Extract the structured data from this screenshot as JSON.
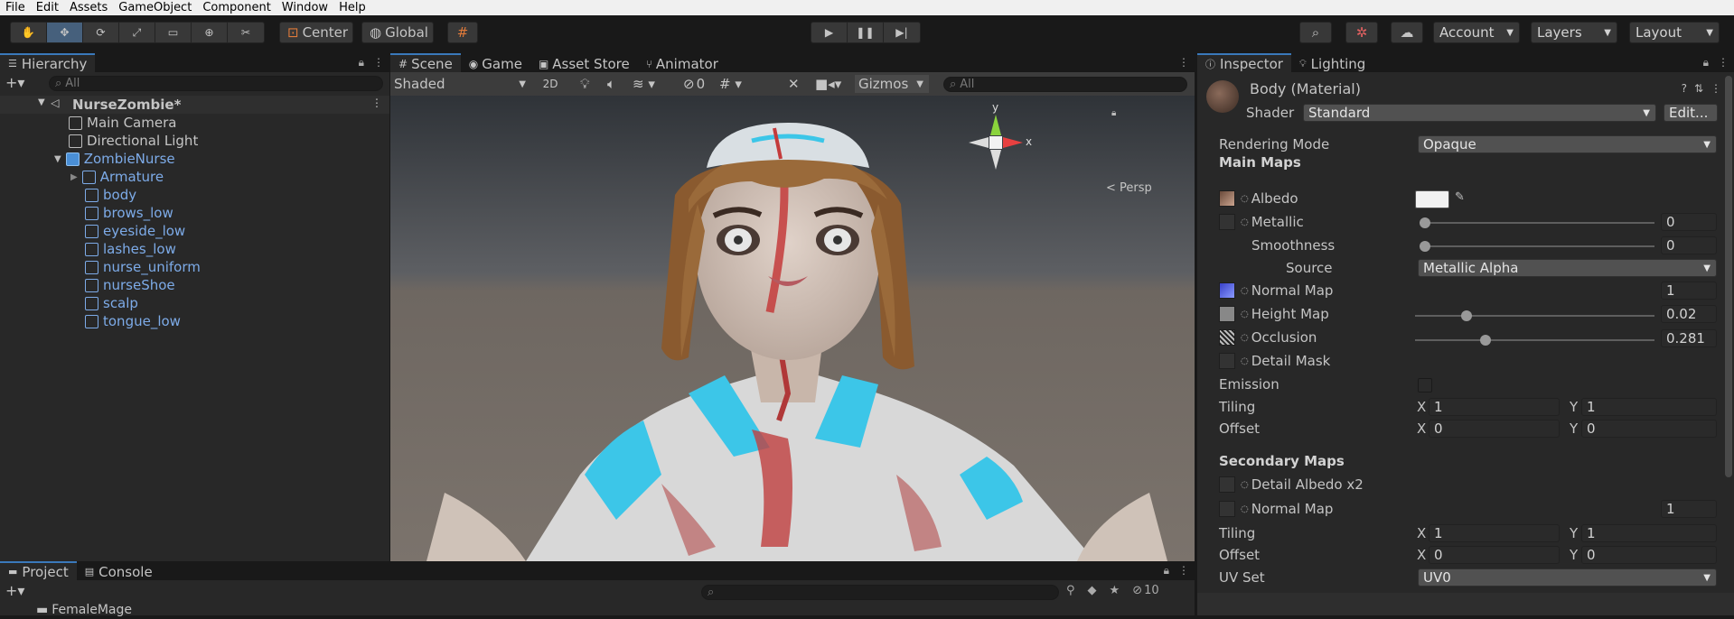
{
  "menu": [
    "File",
    "Edit",
    "Assets",
    "GameObject",
    "Component",
    "Window",
    "Help"
  ],
  "toolbar": {
    "center_label": "Center",
    "global_label": "Global",
    "account_label": "Account",
    "layers_label": "Layers",
    "layout_label": "Layout"
  },
  "hierarchy": {
    "tab": "Hierarchy",
    "search_placeholder": "All",
    "scene_name": "NurseZombie*",
    "items": [
      {
        "label": "Main Camera",
        "prefab": false
      },
      {
        "label": "Directional Light",
        "prefab": false
      },
      {
        "label": "ZombieNurse",
        "prefab": true
      },
      {
        "label": "Armature",
        "prefab": true
      },
      {
        "label": "body",
        "prefab": true
      },
      {
        "label": "brows_low",
        "prefab": true
      },
      {
        "label": "eyeside_low",
        "prefab": true
      },
      {
        "label": "lashes_low",
        "prefab": true
      },
      {
        "label": "nurse_uniform",
        "prefab": true
      },
      {
        "label": "nurseShoe",
        "prefab": true
      },
      {
        "label": "scalp",
        "prefab": true
      },
      {
        "label": "tongue_low",
        "prefab": true
      }
    ]
  },
  "scene": {
    "tabs": [
      "Scene",
      "Game",
      "Asset Store",
      "Animator"
    ],
    "shading": "Shaded",
    "mode_2d": "2D",
    "hidden_count": "0",
    "gizmos": "Gizmos",
    "search_placeholder": "All",
    "persp": "Persp",
    "axis_x": "x",
    "axis_y": "y"
  },
  "inspector": {
    "tabs": [
      "Inspector",
      "Lighting"
    ],
    "material": "Body (Material)",
    "shader_label": "Shader",
    "shader_value": "Standard",
    "edit_button": "Edit...",
    "rendering_mode_label": "Rendering Mode",
    "rendering_mode_value": "Opaque",
    "main_maps": "Main Maps",
    "albedo": "Albedo",
    "metallic": "Metallic",
    "metallic_value": "0",
    "smoothness": "Smoothness",
    "smoothness_value": "0",
    "source": "Source",
    "source_value": "Metallic Alpha",
    "normal_map": "Normal Map",
    "normal_value": "1",
    "height_map": "Height Map",
    "height_value": "0.02",
    "occlusion": "Occlusion",
    "occlusion_value": "0.281",
    "detail_mask": "Detail Mask",
    "emission": "Emission",
    "tiling": "Tiling",
    "offset": "Offset",
    "tiling_x": "1",
    "tiling_y": "1",
    "offset_x": "0",
    "offset_y": "0",
    "secondary_maps": "Secondary Maps",
    "detail_albedo": "Detail Albedo x2",
    "normal_map2": "Normal Map",
    "normal2_value": "1",
    "tiling2_x": "1",
    "tiling2_y": "1",
    "offset2_x": "0",
    "offset2_y": "0",
    "uv_set": "UV Set",
    "uv_value": "UV0",
    "x_label": "X",
    "y_label": "Y",
    "metallic_level": 0.0,
    "smoothness_level": 0.0,
    "height_level": 0.2,
    "occlusion_level": 0.281
  },
  "project": {
    "tabs": [
      "Project",
      "Console"
    ],
    "folder": "FemaleMage",
    "hidden_count": "10"
  }
}
